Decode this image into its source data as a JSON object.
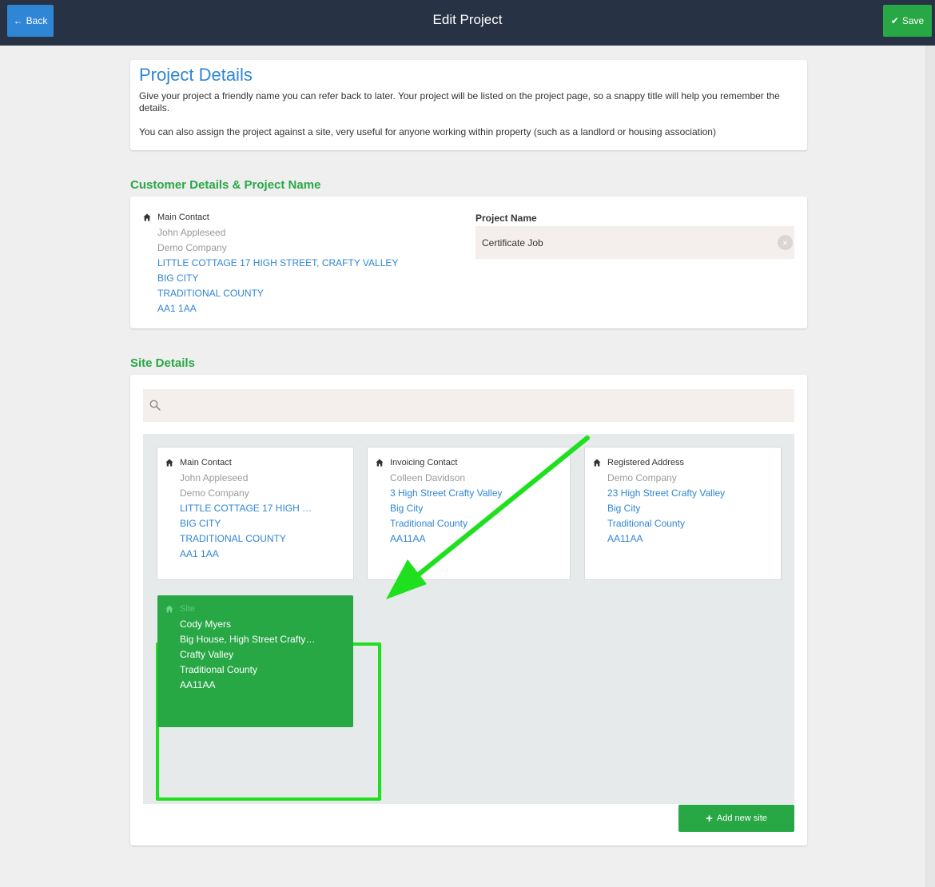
{
  "topbar": {
    "back_label": "Back",
    "title": "Edit Project",
    "save_label": "Save"
  },
  "intro": {
    "title": "Project Details",
    "paragraph1": "Give your project a friendly name you can refer back to later. Your project will be listed on the project page, so a snappy title will help you remember the details.",
    "paragraph2": "You can also assign the project against a site, very useful for anyone working within property (such as a landlord or housing association)"
  },
  "customer_section": {
    "title": "Customer Details & Project Name",
    "main_contact": {
      "label": "Main Contact",
      "name": "John Appleseed",
      "company": "Demo Company",
      "address1": "LITTLE COTTAGE 17 HIGH STREET, CRAFTY VALLEY",
      "city": "BIG CITY",
      "county": "TRADITIONAL COUNTY",
      "postcode": "AA1 1AA"
    },
    "project_name_label": "Project Name",
    "project_name_value": "Certificate Job",
    "clear_icon": "×"
  },
  "site_section": {
    "title": "Site Details",
    "search_placeholder": "",
    "tiles": [
      {
        "label": "Main Contact",
        "name": "John Appleseed",
        "company": "Demo Company",
        "address1": "LITTLE COTTAGE 17 HIGH …",
        "city": "BIG CITY",
        "county": "TRADITIONAL COUNTY",
        "postcode": "AA1 1AA"
      },
      {
        "label": "Invoicing Contact",
        "name": "Colleen Davidson",
        "address1": "3 High Street Crafty Valley",
        "city": "Big City",
        "county": "Traditional County",
        "postcode": "AA11AA"
      },
      {
        "label": "Registered Address",
        "company": "Demo Company",
        "address1": "23 High Street Crafty Valley",
        "city": "Big City",
        "county": "Traditional County",
        "postcode": "AA11AA"
      },
      {
        "label": "Site",
        "name": "Cody Myers",
        "address1": "Big House, High Street Crafty…",
        "city": "Crafty Valley",
        "county": "Traditional County",
        "postcode": "AA11AA",
        "selected": true
      }
    ],
    "add_site_label": "Add new site"
  },
  "icons": {
    "back": "arrow-left-icon",
    "save": "check-icon",
    "home": "home-icon",
    "search": "search-icon",
    "add": "plus-icon",
    "clear": "clear-icon"
  },
  "colors": {
    "topbar": "#273244",
    "primary_blue": "#2f86d4",
    "primary_green": "#28a745",
    "highlight_green": "#1ee01e",
    "muted_text": "#9a9a9a"
  }
}
